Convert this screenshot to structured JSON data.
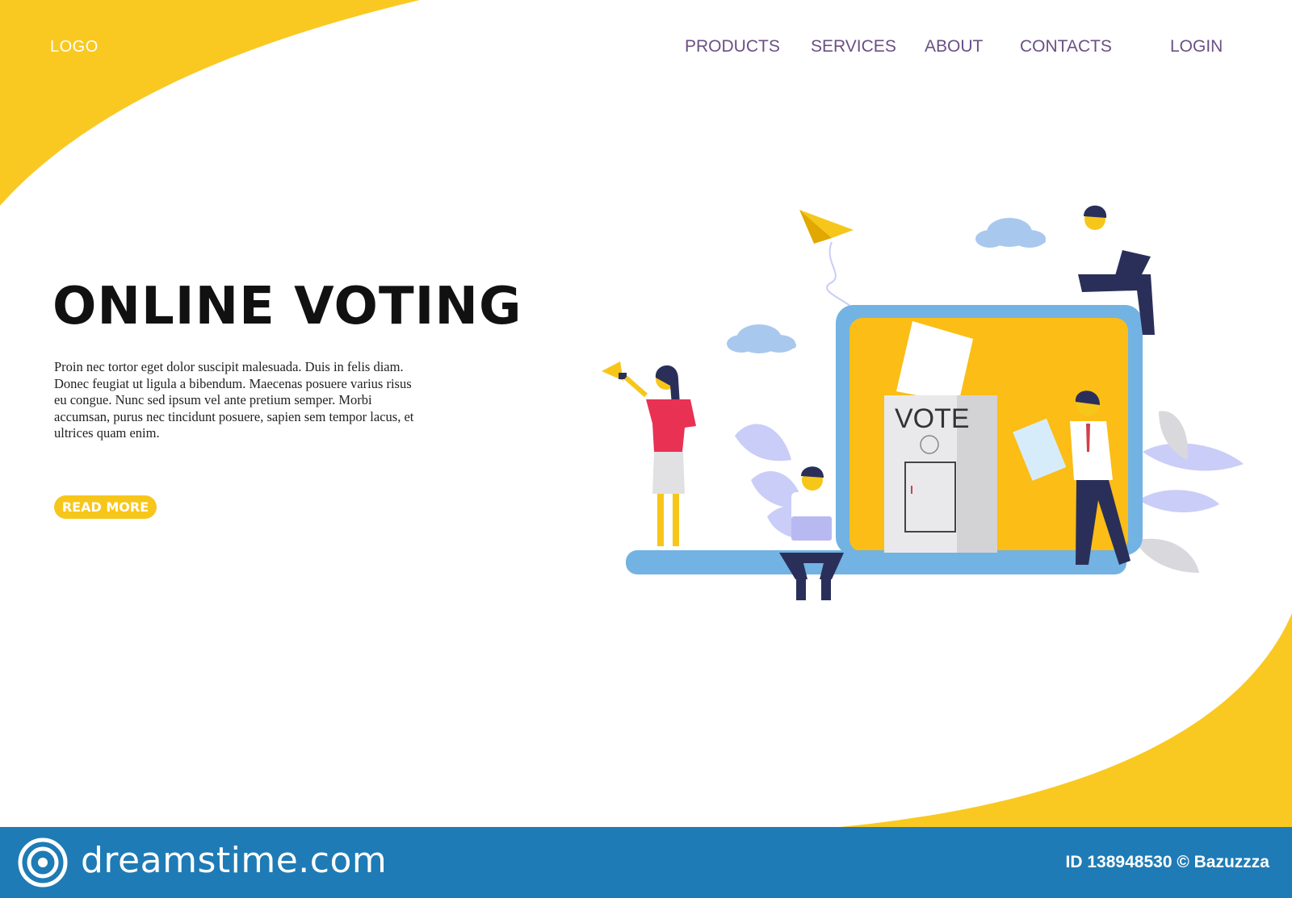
{
  "header": {
    "logo": "LOGO",
    "nav": [
      "PRODUCTS",
      "SERVICES",
      "ABOUT",
      "CONTACTS"
    ],
    "login": "LOGIN"
  },
  "hero": {
    "title": "ONLINE VOTING",
    "body": "Proin nec tortor eget dolor suscipit malesuada. Duis in felis diam. Donec feugiat ut ligula a bibendum. Maecenas posuere varius risus eu congue. Nunc sed ipsum vel ante pretium semper. Morbi accumsan, purus nec tincidunt posuere, sapien sem tempor lacus, et ultrices quam enim.",
    "button": "READ MORE"
  },
  "illustration": {
    "ballot_box_label": "VOTE"
  },
  "watermark": {
    "brand": "dreamstime.com",
    "id_text": "ID 138948530 © Bazuzzza"
  },
  "colors": {
    "accent_yellow": "#f7c61a",
    "nav_purple": "#6b4f84",
    "laptop_blue": "#72b3e3",
    "watermark_blue": "#1f7bb5"
  }
}
